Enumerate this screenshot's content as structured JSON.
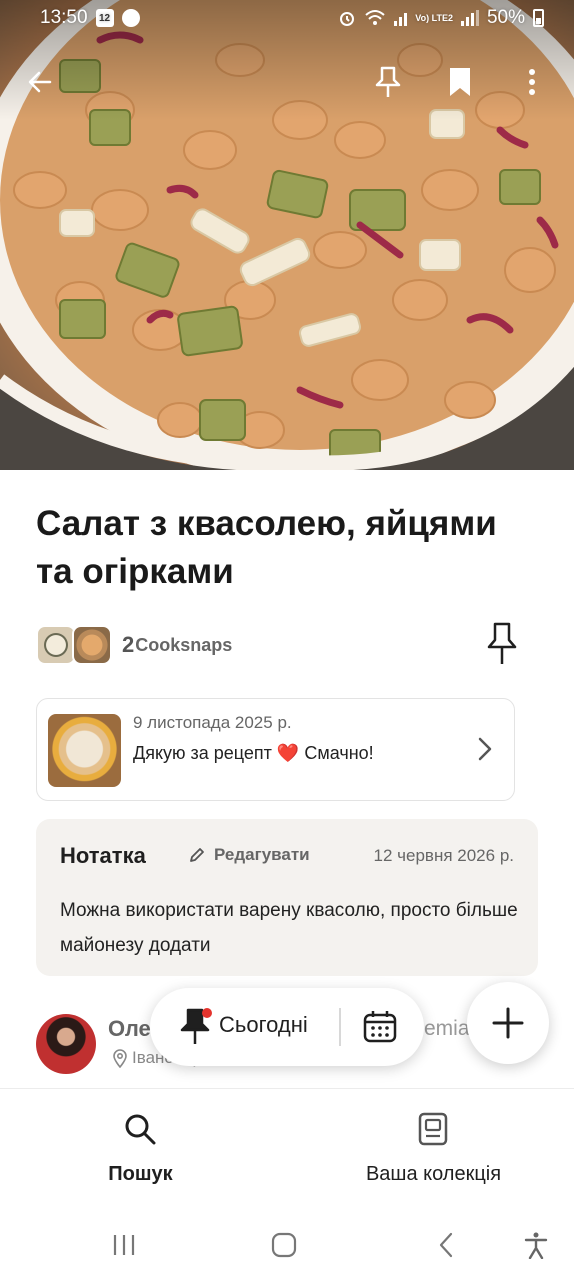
{
  "status_bar": {
    "time": "13:50",
    "battery": "50%",
    "lte": "Vo) LTE2",
    "notification_badge": "12"
  },
  "topbar": {
    "back_icon": "arrow-left-icon",
    "pin_icon": "pin-icon",
    "bookmark_icon": "bookmark-icon",
    "more_icon": "more-vertical-icon"
  },
  "recipe": {
    "title": "Салат з квасолею, яйцями та огірками"
  },
  "cooksnaps": {
    "count": "2",
    "label": "Cooksnaps"
  },
  "cooksnap_card": {
    "date": "9 листопада 2025 р.",
    "text_before": "Дякую за рецепт ",
    "emoji": "❤️",
    "text_after": " Смачно!"
  },
  "note": {
    "title": "Нотатка",
    "edit_label": "Редагувати",
    "date": "12 червня 2026 р.",
    "body": "Можна використати варену квасолю, просто більше майонезу додати"
  },
  "author": {
    "name_partial": "Оле",
    "location_partial": "Івано-Франківськ",
    "obscured_right": "emia"
  },
  "floating": {
    "today_label": "Сьогодні",
    "fab_icon": "plus-icon"
  },
  "bottom_nav": {
    "items": [
      {
        "label": "Пошук",
        "icon": "search-icon",
        "active": true
      },
      {
        "label": "Ваша колекція",
        "icon": "collection-icon",
        "active": false
      }
    ]
  },
  "colors": {
    "accent_red": "#e4332d",
    "note_bg": "#f4f2ef",
    "text_primary": "#1f1f1f",
    "text_secondary": "#666666"
  }
}
